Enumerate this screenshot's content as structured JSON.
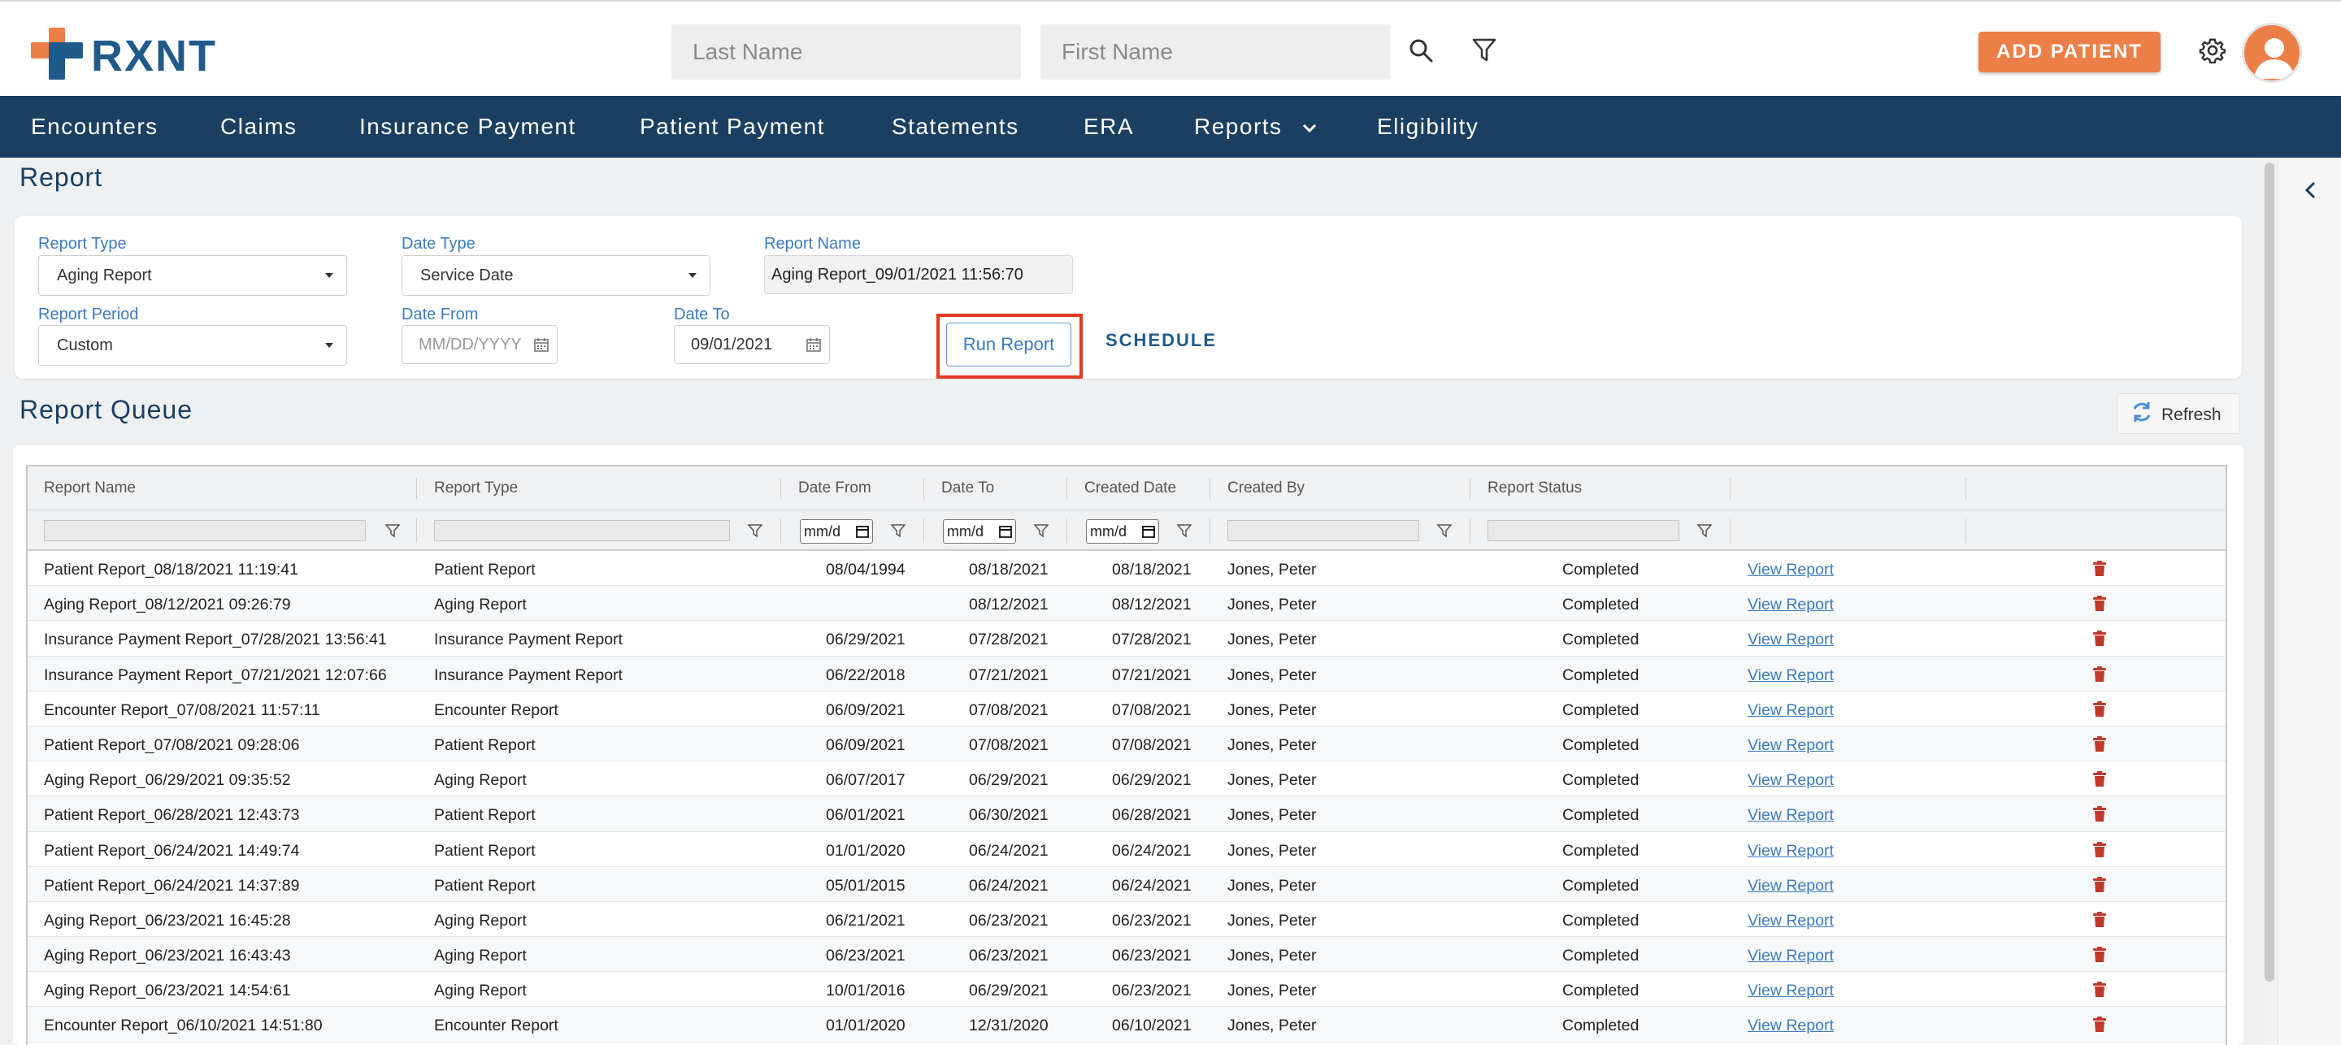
{
  "header": {
    "logo_text": "RXNT",
    "last_name_placeholder": "Last Name",
    "first_name_placeholder": "First Name",
    "add_patient_label": "ADD PATIENT",
    "icons": [
      "search-icon",
      "filter-icon",
      "gear-icon",
      "avatar"
    ]
  },
  "nav": {
    "items": [
      {
        "label": "Encounters"
      },
      {
        "label": "Claims"
      },
      {
        "label": "Insurance Payment"
      },
      {
        "label": "Patient Payment"
      },
      {
        "label": "Statements"
      },
      {
        "label": "ERA"
      },
      {
        "label": "Reports"
      },
      {
        "label": "Eligibility"
      }
    ]
  },
  "report_form": {
    "title": "Report",
    "report_type": {
      "label": "Report Type",
      "value": "Aging Report"
    },
    "date_type": {
      "label": "Date Type",
      "value": "Service Date"
    },
    "report_name": {
      "label": "Report Name",
      "value": "Aging Report_09/01/2021 11:56:70"
    },
    "report_period": {
      "label": "Report Period",
      "value": "Custom"
    },
    "date_from": {
      "label": "Date From",
      "placeholder": "MM/DD/YYYY"
    },
    "date_to": {
      "label": "Date To",
      "value": "09/01/2021"
    },
    "run_report_label": "Run Report",
    "schedule_label": "SCHEDULE"
  },
  "queue": {
    "title": "Report Queue",
    "refresh_label": "Refresh",
    "columns": [
      "Report Name",
      "Report Type",
      "Date From",
      "Date To",
      "Created Date",
      "Created By",
      "Report Status",
      "",
      ""
    ],
    "date_filter_text": "mm/d",
    "rows": [
      {
        "name": "Patient Report_08/18/2021 11:19:41",
        "type": "Patient Report",
        "from": "08/04/1994",
        "to": "08/18/2021",
        "created": "08/18/2021",
        "by": "Jones, Peter",
        "status": "Completed",
        "link": "View Report"
      },
      {
        "name": "Aging Report_08/12/2021 09:26:79",
        "type": "Aging Report",
        "from": "",
        "to": "08/12/2021",
        "created": "08/12/2021",
        "by": "Jones, Peter",
        "status": "Completed",
        "link": "View Report"
      },
      {
        "name": "Insurance Payment Report_07/28/2021 13:56:41",
        "type": "Insurance Payment Report",
        "from": "06/29/2021",
        "to": "07/28/2021",
        "created": "07/28/2021",
        "by": "Jones, Peter",
        "status": "Completed",
        "link": "View Report"
      },
      {
        "name": "Insurance Payment Report_07/21/2021 12:07:66",
        "type": "Insurance Payment Report",
        "from": "06/22/2018",
        "to": "07/21/2021",
        "created": "07/21/2021",
        "by": "Jones, Peter",
        "status": "Completed",
        "link": "View Report"
      },
      {
        "name": "Encounter Report_07/08/2021 11:57:11",
        "type": "Encounter Report",
        "from": "06/09/2021",
        "to": "07/08/2021",
        "created": "07/08/2021",
        "by": "Jones, Peter",
        "status": "Completed",
        "link": "View Report"
      },
      {
        "name": "Patient Report_07/08/2021 09:28:06",
        "type": "Patient Report",
        "from": "06/09/2021",
        "to": "07/08/2021",
        "created": "07/08/2021",
        "by": "Jones, Peter",
        "status": "Completed",
        "link": "View Report"
      },
      {
        "name": "Aging Report_06/29/2021 09:35:52",
        "type": "Aging Report",
        "from": "06/07/2017",
        "to": "06/29/2021",
        "created": "06/29/2021",
        "by": "Jones, Peter",
        "status": "Completed",
        "link": "View Report"
      },
      {
        "name": "Patient Report_06/28/2021 12:43:73",
        "type": "Patient Report",
        "from": "06/01/2021",
        "to": "06/30/2021",
        "created": "06/28/2021",
        "by": "Jones, Peter",
        "status": "Completed",
        "link": "View Report"
      },
      {
        "name": "Patient Report_06/24/2021 14:49:74",
        "type": "Patient Report",
        "from": "01/01/2020",
        "to": "06/24/2021",
        "created": "06/24/2021",
        "by": "Jones, Peter",
        "status": "Completed",
        "link": "View Report"
      },
      {
        "name": "Patient Report_06/24/2021 14:37:89",
        "type": "Patient Report",
        "from": "05/01/2015",
        "to": "06/24/2021",
        "created": "06/24/2021",
        "by": "Jones, Peter",
        "status": "Completed",
        "link": "View Report"
      },
      {
        "name": "Aging Report_06/23/2021 16:45:28",
        "type": "Aging Report",
        "from": "06/21/2021",
        "to": "06/23/2021",
        "created": "06/23/2021",
        "by": "Jones, Peter",
        "status": "Completed",
        "link": "View Report"
      },
      {
        "name": "Aging Report_06/23/2021 16:43:43",
        "type": "Aging Report",
        "from": "06/23/2021",
        "to": "06/23/2021",
        "created": "06/23/2021",
        "by": "Jones, Peter",
        "status": "Completed",
        "link": "View Report"
      },
      {
        "name": "Aging Report_06/23/2021 14:54:61",
        "type": "Aging Report",
        "from": "10/01/2016",
        "to": "06/29/2021",
        "created": "06/23/2021",
        "by": "Jones, Peter",
        "status": "Completed",
        "link": "View Report"
      },
      {
        "name": "Encounter Report_06/10/2021 14:51:80",
        "type": "Encounter Report",
        "from": "01/01/2020",
        "to": "12/31/2020",
        "created": "06/10/2021",
        "by": "Jones, Peter",
        "status": "Completed",
        "link": "View Report"
      }
    ]
  },
  "colors": {
    "nav_bg": "#1b3f60",
    "accent_orange": "#ec7f47",
    "link_blue": "#3b7bbf",
    "highlight_red": "#e03a1f",
    "trash_red": "#c0392b"
  }
}
